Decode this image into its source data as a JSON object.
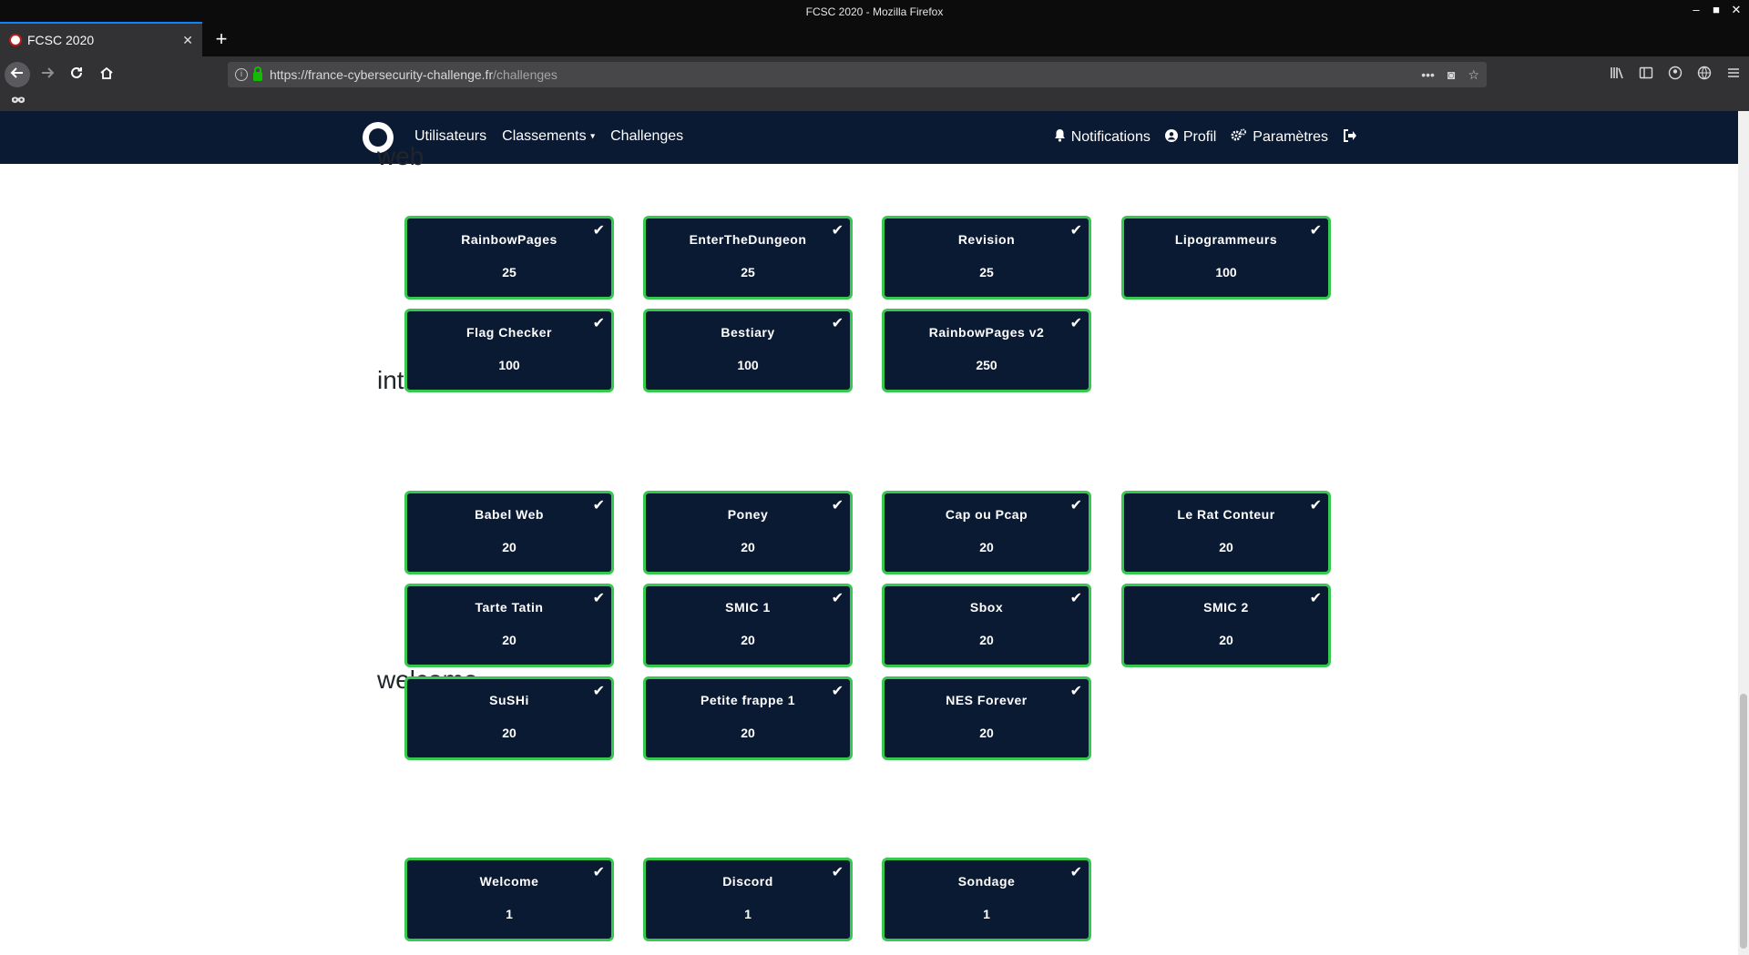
{
  "window": {
    "title": "FCSC 2020 - Mozilla Firefox",
    "controls": [
      "–",
      "■",
      "✕"
    ]
  },
  "tab": {
    "title": "FCSC 2020",
    "close": "✕",
    "new_tab": "+"
  },
  "urlbar": {
    "host": "https://france-cybersecurity-challenge.fr",
    "path": "/challenges",
    "actions": [
      "•••",
      "◙",
      "☆"
    ]
  },
  "toolbar_icons": [
    "library-icon",
    "sidebar-icon",
    "account-icon",
    "globe-icon",
    "menu-icon"
  ],
  "site_nav": {
    "left": [
      "Utilisateurs",
      "Classements",
      "Challenges"
    ],
    "notifications": "Notifications",
    "profile": "Profil",
    "settings": "Paramètres"
  },
  "categories": [
    {
      "name": "web",
      "challenges": [
        {
          "name": "RainbowPages",
          "points": "25"
        },
        {
          "name": "EnterTheDungeon",
          "points": "25"
        },
        {
          "name": "Revision",
          "points": "25"
        },
        {
          "name": "Lipogrammeurs",
          "points": "100"
        },
        {
          "name": "Flag Checker",
          "points": "100"
        },
        {
          "name": "Bestiary",
          "points": "100"
        },
        {
          "name": "RainbowPages v2",
          "points": "250"
        }
      ]
    },
    {
      "name": "intro",
      "challenges": [
        {
          "name": "Babel Web",
          "points": "20"
        },
        {
          "name": "Poney",
          "points": "20"
        },
        {
          "name": "Cap ou Pcap",
          "points": "20"
        },
        {
          "name": "Le Rat Conteur",
          "points": "20"
        },
        {
          "name": "Tarte Tatin",
          "points": "20"
        },
        {
          "name": "SMIC 1",
          "points": "20"
        },
        {
          "name": "Sbox",
          "points": "20"
        },
        {
          "name": "SMIC 2",
          "points": "20"
        },
        {
          "name": "SuSHi",
          "points": "20"
        },
        {
          "name": "Petite frappe 1",
          "points": "20"
        },
        {
          "name": "NES Forever",
          "points": "20"
        }
      ]
    },
    {
      "name": "welcome",
      "challenges": [
        {
          "name": "Welcome",
          "points": "1"
        },
        {
          "name": "Discord",
          "points": "1"
        },
        {
          "name": "Sondage",
          "points": "1"
        }
      ]
    }
  ],
  "colors": {
    "card_bg": "#0b1a33",
    "card_border": "#37c84f",
    "nav_bg": "#0b1a33"
  }
}
